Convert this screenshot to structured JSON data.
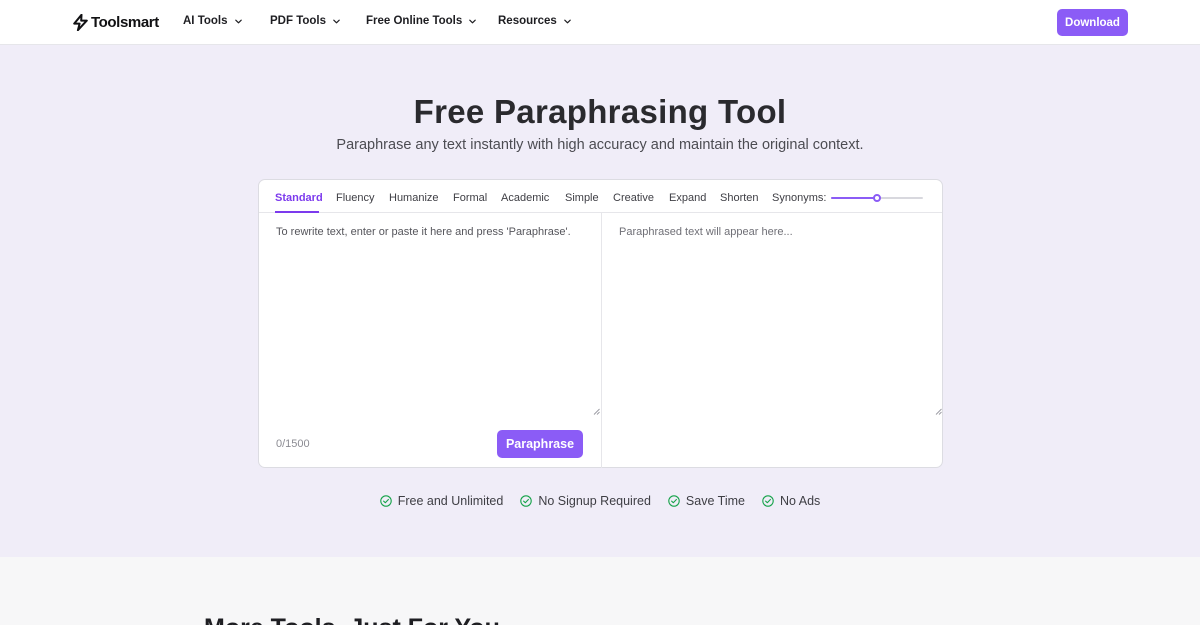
{
  "brand": {
    "name": "Toolsmart",
    "accent": "#8b5cf6",
    "active_tab_color": "#7c3aed",
    "check_color": "#16a34a"
  },
  "nav": {
    "items": [
      {
        "label": "AI Tools",
        "icon": "chevron-down-icon"
      },
      {
        "label": "PDF Tools",
        "icon": "chevron-down-icon"
      },
      {
        "label": "Free Online Tools",
        "icon": "chevron-down-icon"
      },
      {
        "label": "Resources",
        "icon": "chevron-down-icon"
      }
    ],
    "download_label": "Download"
  },
  "hero": {
    "title": "Free Paraphrasing Tool",
    "subtitle": "Paraphrase any text instantly with high accuracy and maintain the original context."
  },
  "tool": {
    "modes": [
      "Standard",
      "Fluency",
      "Humanize",
      "Formal",
      "Academic",
      "Simple",
      "Creative",
      "Expand",
      "Shorten"
    ],
    "active_mode": "Standard",
    "synonyms_label": "Synonyms:",
    "synonyms_level": 0.5,
    "input_placeholder": "To rewrite text, enter or paste it here and press 'Paraphrase'.",
    "output_placeholder": "Paraphrased text will appear here...",
    "char_count": "0/1500",
    "paraphrase_label": "Paraphrase"
  },
  "features": [
    "Free and Unlimited",
    "No Signup Required",
    "Save Time",
    "No Ads"
  ],
  "more_tools": {
    "title": "More Tools, Just For You"
  }
}
